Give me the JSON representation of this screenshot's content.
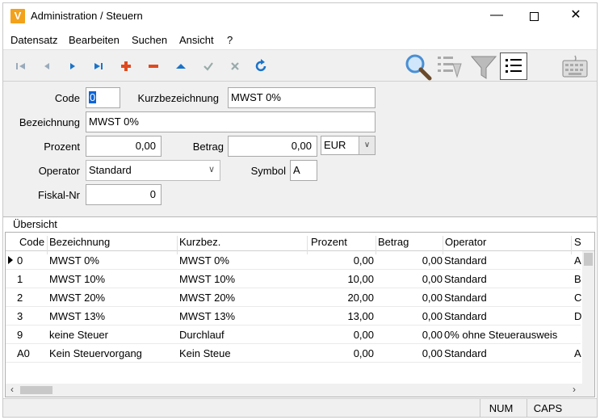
{
  "window": {
    "title": "Administration / Steuern",
    "app_icon_letter": "V"
  },
  "menu": [
    "Datensatz",
    "Bearbeiten",
    "Suchen",
    "Ansicht",
    "?"
  ],
  "form": {
    "code_label": "Code",
    "code_value": "0",
    "kurz_label": "Kurzbezeichnung",
    "kurz_value": "MWST 0%",
    "bez_label": "Bezeichnung",
    "bez_value": "MWST 0%",
    "prozent_label": "Prozent",
    "prozent_value": "0,00",
    "betrag_label": "Betrag",
    "betrag_value": "0,00",
    "currency_value": "EUR",
    "operator_label": "Operator",
    "operator_value": "Standard",
    "symbol_label": "Symbol",
    "symbol_value": "A",
    "fiskal_label": "Fiskal-Nr",
    "fiskal_value": "0"
  },
  "overview": {
    "title": "Übersicht",
    "columns": [
      "Code",
      "Bezeichnung",
      "Kurzbez.",
      "Prozent",
      "Betrag",
      "Operator",
      "S"
    ],
    "rows": [
      [
        "0",
        "MWST 0%",
        "MWST 0%",
        "0,00",
        "0,00",
        "Standard",
        "A"
      ],
      [
        "1",
        "MWST 10%",
        "MWST 10%",
        "10,00",
        "0,00",
        "Standard",
        "B"
      ],
      [
        "2",
        "MWST 20%",
        "MWST 20%",
        "20,00",
        "0,00",
        "Standard",
        "C"
      ],
      [
        "3",
        "MWST 13%",
        "MWST 13%",
        "13,00",
        "0,00",
        "Standard",
        "D"
      ],
      [
        "9",
        "keine Steuer",
        "Durchlauf",
        "0,00",
        "0,00",
        "0% ohne Steuerausweis",
        ""
      ],
      [
        "A0",
        "Kein Steuervorgang",
        "Kein Steue",
        "0,00",
        "0,00",
        "Standard",
        "A"
      ]
    ]
  },
  "status": {
    "num": "NUM",
    "caps": "CAPS"
  },
  "colors": {
    "accent_blue": "#1a73c9",
    "add_red": "#e04a1e",
    "app_orange": "#f2a21b"
  }
}
